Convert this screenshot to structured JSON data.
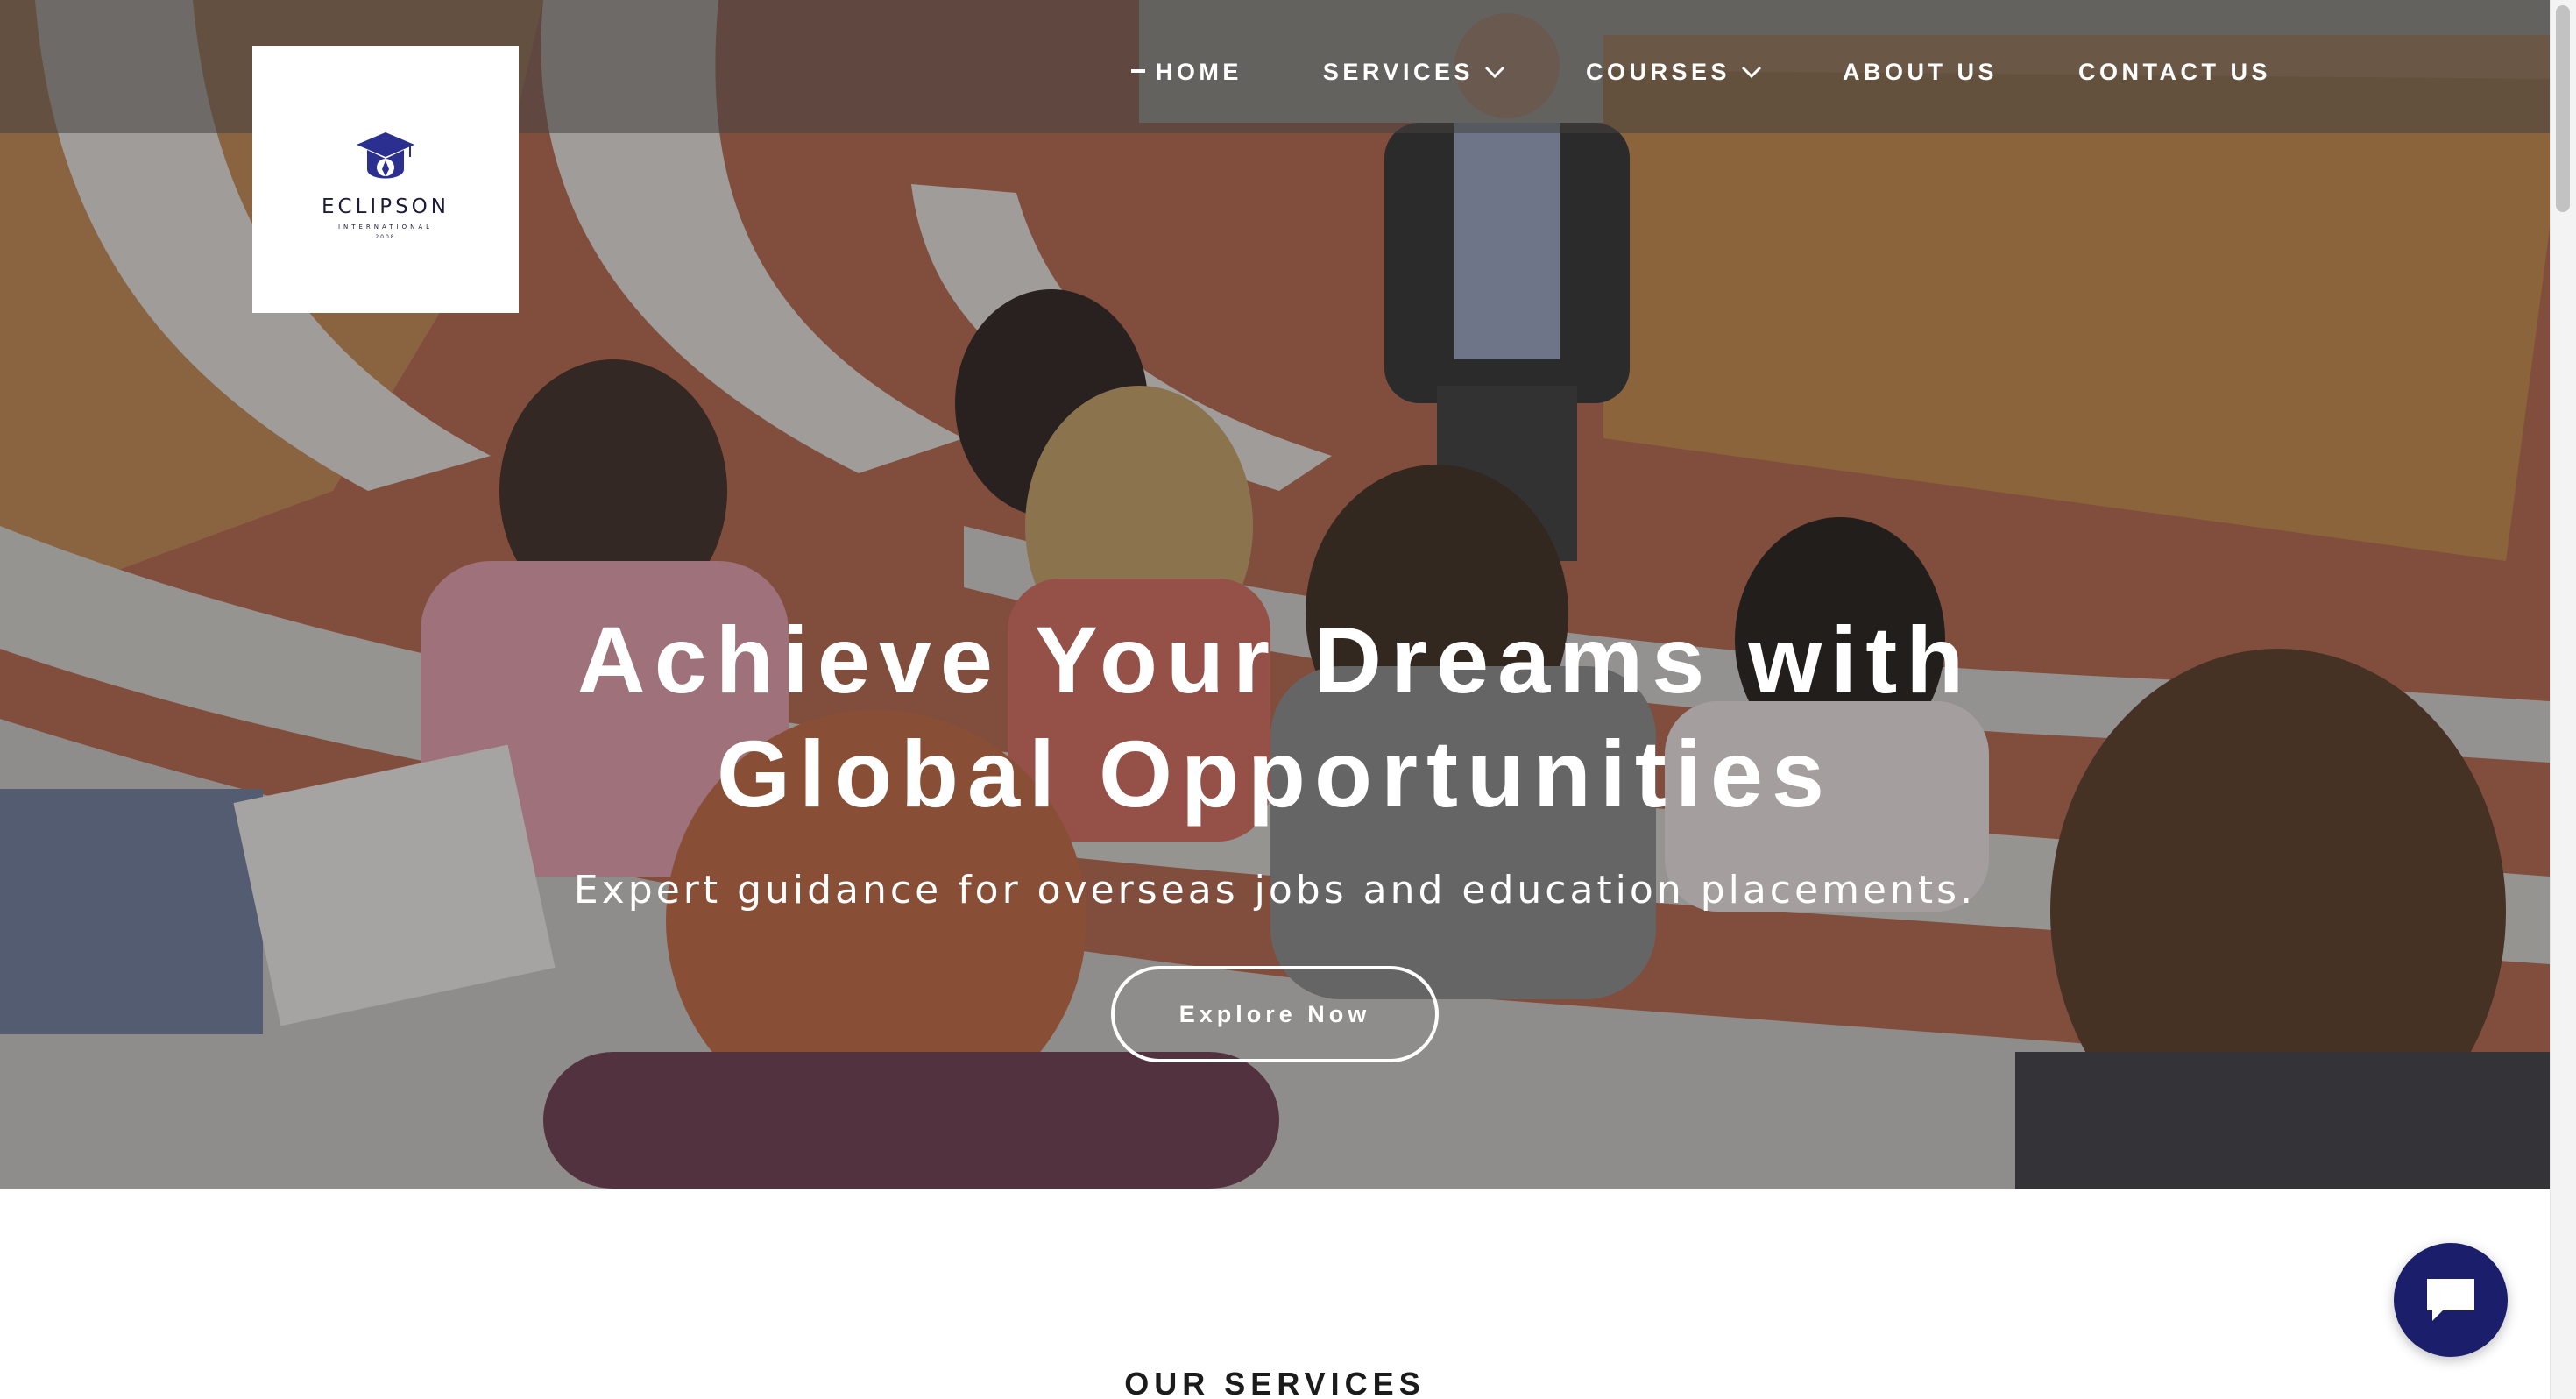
{
  "brand": {
    "name": "ECLIPSON",
    "sub": "INTERNATIONAL",
    "year": "2008",
    "logo_icon": "graduation-cap-icon",
    "color": "#1d1b3a"
  },
  "nav": {
    "items": [
      {
        "label": "HOME",
        "active": true
      },
      {
        "label": "SERVICES",
        "dropdown": true
      },
      {
        "label": "COURSES",
        "dropdown": true
      },
      {
        "label": "ABOUT US"
      },
      {
        "label": "CONTACT US"
      }
    ]
  },
  "hero": {
    "title_line1": "Achieve Your Dreams with",
    "title_line2": "Global Opportunities",
    "subtitle": "Expert guidance for overseas jobs and education placements.",
    "cta_label": "Explore Now"
  },
  "section": {
    "heading": "OUR SERVICES"
  },
  "chat": {
    "icon": "chat-bubble-icon",
    "color": "#1b1f6b"
  }
}
